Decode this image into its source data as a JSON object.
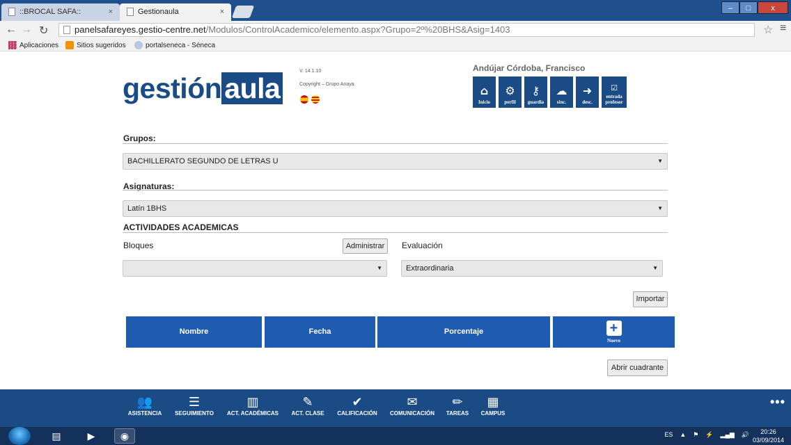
{
  "browser": {
    "tabs": [
      {
        "label": "::BROCAL SAFA::",
        "active": false
      },
      {
        "label": "Gestionaula",
        "active": true
      }
    ],
    "tab_close": "×",
    "url_host": "panelsafareyes.gestio-centre.net",
    "url_path": "/Modulos/ControlAcademico/elemento.aspx?Grupo=2º%20BHS&Asig=1403",
    "bookmarks": [
      "Aplicaciones",
      "Sitios sugeridos",
      "portalseneca - Séneca"
    ]
  },
  "header": {
    "logo_left": "gestión",
    "logo_box": "aula",
    "version": "V. 14.1.10",
    "copyright": "Copyright – Grupo Anaya",
    "user": "Andújar Córdoba, Francisco",
    "icons": [
      {
        "label": "Inicio",
        "icon": "home-icon",
        "glyph": "⌂"
      },
      {
        "label": "perfil",
        "icon": "gears-icon",
        "glyph": "⚙"
      },
      {
        "label": "guardia",
        "icon": "key-icon",
        "glyph": "⚷"
      },
      {
        "label": "sinc.",
        "icon": "cloud-upload-icon",
        "glyph": "☁"
      },
      {
        "label": "desc.",
        "icon": "logout-icon",
        "glyph": "➜"
      },
      {
        "label": "entrada",
        "label2": "profesor",
        "icon": "checkbox-icon",
        "glyph": "☑"
      }
    ]
  },
  "form": {
    "grupos_label": "Grupos:",
    "grupos_value": "BACHILLERATO SEGUNDO DE LETRAS U",
    "asignaturas_label": "Asignaturas:",
    "asignaturas_value": "Latín 1BHS",
    "section_title": "ACTIVIDADES ACADEMICAS",
    "bloques_label": "Bloques",
    "administrar": "Administrar",
    "evaluacion_label": "Evaluación",
    "bloques_value": "",
    "evaluacion_value": "Extraordinaria",
    "importar": "Importar",
    "abrir_cuadrante": "Abrir cuadrante"
  },
  "table": {
    "headers": [
      "Nombre",
      "Fecha",
      "Porcentaje"
    ],
    "nuevo": "Nuevo"
  },
  "footer": {
    "items": [
      {
        "label": "ASISTENCIA",
        "icon": "group-icon",
        "glyph": "👥"
      },
      {
        "label": "SEGUIMIENTO",
        "icon": "list-icon",
        "glyph": "☰"
      },
      {
        "label": "ACT. ACADÉMICAS",
        "icon": "bar-chart-icon",
        "glyph": "▥"
      },
      {
        "label": "ACT. CLASE",
        "icon": "edit-icon",
        "glyph": "✎"
      },
      {
        "label": "CALIFICACIÓN",
        "icon": "check-circle-icon",
        "glyph": "✔"
      },
      {
        "label": "COMUNICACIÓN",
        "icon": "envelope-icon",
        "glyph": "✉"
      },
      {
        "label": "TAREAS",
        "icon": "pencil-icon",
        "glyph": "✏"
      },
      {
        "label": "CAMPUS",
        "icon": "building-icon",
        "glyph": "▦"
      }
    ],
    "more": "•••"
  },
  "taskbar": {
    "lang": "ES",
    "time": "20:26",
    "date": "03/09/2014"
  }
}
